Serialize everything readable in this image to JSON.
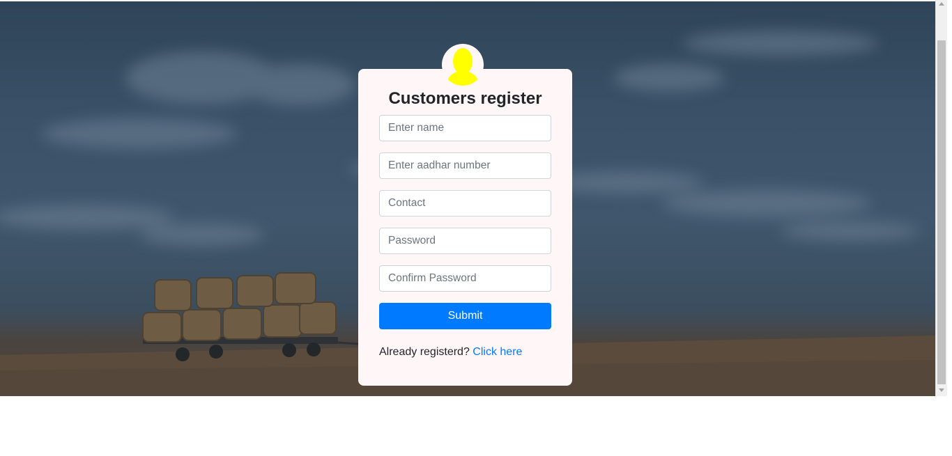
{
  "form": {
    "title": "Customers register",
    "name_placeholder": "Enter name",
    "aadhar_placeholder": "Enter aadhar number",
    "contact_placeholder": "Contact",
    "password_placeholder": "Password",
    "confirm_password_placeholder": "Confirm Password",
    "submit_label": "Submit",
    "already_text": "Already registerd?",
    "login_link": "Click here"
  },
  "icons": {
    "avatar": "user-silhouette-icon"
  },
  "colors": {
    "primary": "#007bff",
    "avatar": "#ffff00",
    "card_background": "#fff7f7",
    "title_text": "#212529"
  }
}
